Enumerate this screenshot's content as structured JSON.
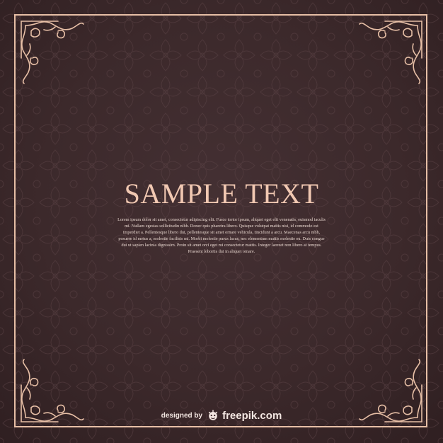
{
  "title": "SAMPLE TEXT",
  "body": "Lorem ipsum dolor sit amet, consectetur adipiscing elit. Fusce tortor ipsum, aliquet eget elit venenatis, euismod iaculis mi. Nullam egestas sollicitudin nibh. Donec quis pharetra libero. Quisque volutpat mattis nisi, id commodo est imperdiet a. Pellentesque libero dui, pellentesque sit amet ornare vehicula, tincidunt a arcu. Maecenas arcu nibh, posuere id metus a, molestie facilisis mi. Morbi molestie purus lacus, nec elementum mattis molestie eu. Duis congue dui ut sapien lacinia dignissim. Proin sit amet orci eget mi consectetur mattis. Integer laoreet non libero at tempus. Praesent lobortis dui in aliquet ornare.",
  "credit": {
    "prefix": "designed by",
    "brand": "freepik.com",
    "icon": "freepik-logo-icon"
  },
  "colors": {
    "background": "#3a2628",
    "ornament": "#e7bfa6",
    "title": "#f1c8b2"
  }
}
